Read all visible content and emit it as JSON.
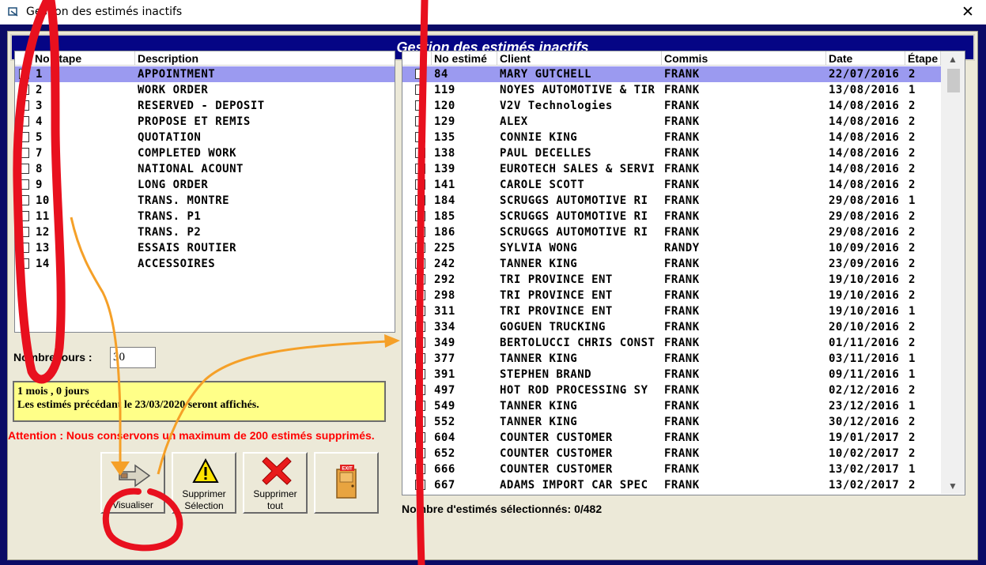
{
  "window": {
    "title": "Gestion des estimés inactifs",
    "close_glyph": "✕"
  },
  "header": {
    "title": "Gestion des estimés inactifs"
  },
  "left_list": {
    "columns": [
      "No étape",
      "Description"
    ],
    "rows": [
      {
        "checked": true,
        "no": "1",
        "description": "APPOINTMENT",
        "selected": true
      },
      {
        "checked": true,
        "no": "2",
        "description": "WORK ORDER"
      },
      {
        "checked": false,
        "no": "3",
        "description": "RESERVED - DEPOSIT"
      },
      {
        "checked": false,
        "no": "4",
        "description": "PROPOSE ET REMIS"
      },
      {
        "checked": false,
        "no": "5",
        "description": "QUOTATION"
      },
      {
        "checked": false,
        "no": "7",
        "description": "COMPLETED WORK"
      },
      {
        "checked": false,
        "no": "8",
        "description": "NATIONAL ACOUNT"
      },
      {
        "checked": false,
        "no": "9",
        "description": "LONG ORDER"
      },
      {
        "checked": false,
        "no": "10",
        "description": "TRANS. MONTRE"
      },
      {
        "checked": false,
        "no": "11",
        "description": "TRANS. P1"
      },
      {
        "checked": false,
        "no": "12",
        "description": "TRANS. P2"
      },
      {
        "checked": false,
        "no": "13",
        "description": "ESSAIS ROUTIER"
      },
      {
        "checked": false,
        "no": "14",
        "description": "ACCESSOIRES"
      }
    ]
  },
  "right_list": {
    "columns": [
      "No estimé",
      "Client",
      "Commis",
      "Date",
      "Étape"
    ],
    "rows": [
      {
        "no": "84",
        "client": "MARY GUTCHELL",
        "commis": "FRANK",
        "date": "22/07/2016",
        "etape": "2",
        "selected": true
      },
      {
        "no": "119",
        "client": "NOYES AUTOMOTIVE & TIR",
        "commis": "FRANK",
        "date": "13/08/2016",
        "etape": "1"
      },
      {
        "no": "120",
        "client": "V2V Technologies",
        "commis": "FRANK",
        "date": "14/08/2016",
        "etape": "2"
      },
      {
        "no": "129",
        "client": "ALEX",
        "commis": "FRANK",
        "date": "14/08/2016",
        "etape": "2"
      },
      {
        "no": "135",
        "client": "CONNIE KING",
        "commis": "FRANK",
        "date": "14/08/2016",
        "etape": "2"
      },
      {
        "no": "138",
        "client": "PAUL DECELLES",
        "commis": "FRANK",
        "date": "14/08/2016",
        "etape": "2"
      },
      {
        "no": "139",
        "client": "EUROTECH SALES & SERVI",
        "commis": "FRANK",
        "date": "14/08/2016",
        "etape": "2"
      },
      {
        "no": "141",
        "client": "CAROLE SCOTT",
        "commis": "FRANK",
        "date": "14/08/2016",
        "etape": "2"
      },
      {
        "no": "184",
        "client": "SCRUGGS AUTOMOTIVE RI",
        "commis": "FRANK",
        "date": "29/08/2016",
        "etape": "1"
      },
      {
        "no": "185",
        "client": "SCRUGGS AUTOMOTIVE RI",
        "commis": "FRANK",
        "date": "29/08/2016",
        "etape": "2"
      },
      {
        "no": "186",
        "client": "SCRUGGS AUTOMOTIVE RI",
        "commis": "FRANK",
        "date": "29/08/2016",
        "etape": "2"
      },
      {
        "no": "225",
        "client": "SYLVIA WONG",
        "commis": "RANDY",
        "date": "10/09/2016",
        "etape": "2"
      },
      {
        "no": "242",
        "client": "TANNER KING",
        "commis": "FRANK",
        "date": "23/09/2016",
        "etape": "2"
      },
      {
        "no": "292",
        "client": "TRI PROVINCE ENT",
        "commis": "FRANK",
        "date": "19/10/2016",
        "etape": "2"
      },
      {
        "no": "298",
        "client": "TRI PROVINCE ENT",
        "commis": "FRANK",
        "date": "19/10/2016",
        "etape": "2"
      },
      {
        "no": "311",
        "client": "TRI PROVINCE ENT",
        "commis": "FRANK",
        "date": "19/10/2016",
        "etape": "1"
      },
      {
        "no": "334",
        "client": "GOGUEN TRUCKING",
        "commis": "FRANK",
        "date": "20/10/2016",
        "etape": "2"
      },
      {
        "no": "349",
        "client": "BERTOLUCCI CHRIS CONST",
        "commis": "FRANK",
        "date": "01/11/2016",
        "etape": "2"
      },
      {
        "no": "377",
        "client": "TANNER KING",
        "commis": "FRANK",
        "date": "03/11/2016",
        "etape": "1"
      },
      {
        "no": "391",
        "client": "STEPHEN BRAND",
        "commis": "FRANK",
        "date": "09/11/2016",
        "etape": "1"
      },
      {
        "no": "497",
        "client": "HOT ROD  PROCESSING SY",
        "commis": "FRANK",
        "date": "02/12/2016",
        "etape": "2"
      },
      {
        "no": "549",
        "client": "TANNER KING",
        "commis": "FRANK",
        "date": "23/12/2016",
        "etape": "1"
      },
      {
        "no": "552",
        "client": "TANNER KING",
        "commis": "FRANK",
        "date": "30/12/2016",
        "etape": "2"
      },
      {
        "no": "604",
        "client": "COUNTER CUSTOMER",
        "commis": "FRANK",
        "date": "19/01/2017",
        "etape": "2"
      },
      {
        "no": "652",
        "client": "COUNTER CUSTOMER",
        "commis": "FRANK",
        "date": "10/02/2017",
        "etape": "2"
      },
      {
        "no": "666",
        "client": "COUNTER CUSTOMER",
        "commis": "FRANK",
        "date": "13/02/2017",
        "etape": "1"
      },
      {
        "no": "667",
        "client": "ADAMS IMPORT CAR SPEC",
        "commis": "FRANK",
        "date": "13/02/2017",
        "etape": "2"
      }
    ]
  },
  "days": {
    "label": "Nombre jours :",
    "value": "30"
  },
  "info": {
    "line1": "1 mois , 0 jours",
    "line2": "Les estimés précédant le 23/03/2020 seront affichés."
  },
  "warning": "Attention : Nous conservons un maximum de 200 estimés supprimés.",
  "buttons": {
    "view": "Visualiser",
    "delete_selection_1": "Supprimer",
    "delete_selection_2": "Sélection",
    "delete_all_1": "Supprimer",
    "delete_all_2": "tout",
    "exit_sign": "EXIT"
  },
  "selected_count": "Nombre d'estimés sélectionnés: 0/482",
  "colors": {
    "selection": "#9b9af0",
    "banner": "#050585",
    "info_bg": "#ffff88",
    "warning": "#ff0000",
    "annotation_red": "#e8101e",
    "annotation_orange": "#f5a028"
  }
}
